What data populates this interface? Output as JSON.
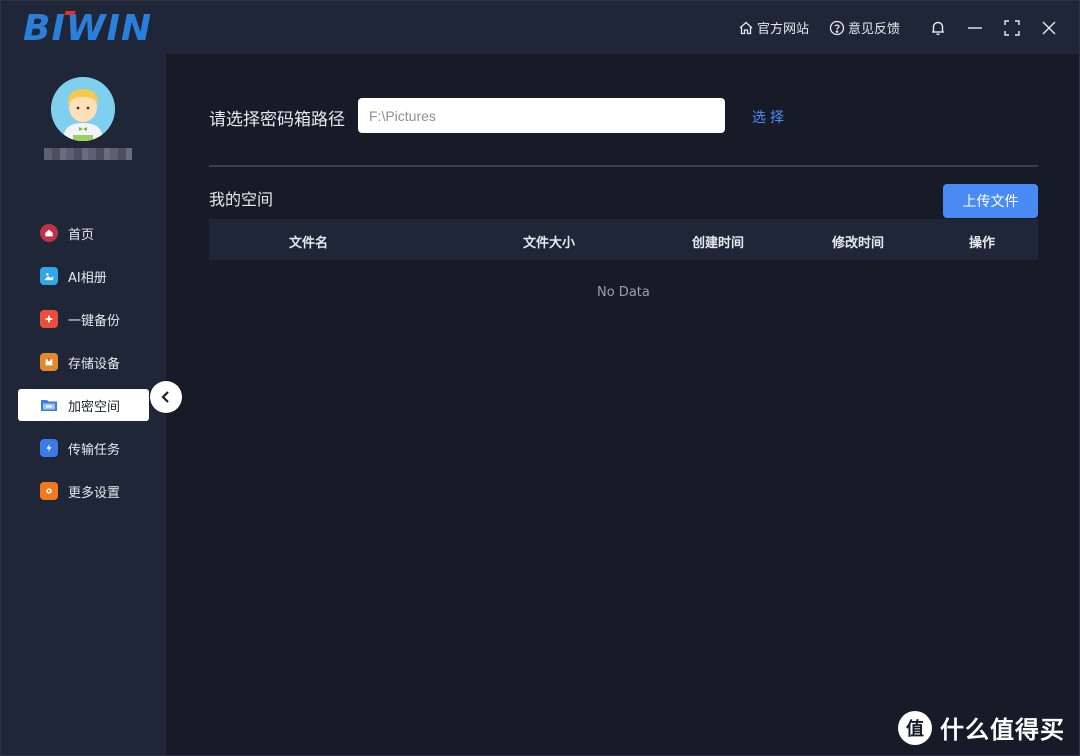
{
  "brand": {
    "logo_text": "BIWIN",
    "colors": {
      "logo": "#2b7fd9",
      "accent": "#4a8af4",
      "logo_dot": "#e03030"
    }
  },
  "titlebar": {
    "official_site": "官方网站",
    "feedback": "意见反馈",
    "icons": [
      "home-icon",
      "help-icon",
      "bell-icon",
      "minimize-icon",
      "fullscreen-icon",
      "close-icon"
    ]
  },
  "sidebar": {
    "items": [
      {
        "label": "首页",
        "icon": "home-circle-icon",
        "color": "#c0314a"
      },
      {
        "label": "AI相册",
        "icon": "photo-album-icon",
        "color": "#2fa7e8"
      },
      {
        "label": "一键备份",
        "icon": "backup-icon",
        "color": "#e94f3b"
      },
      {
        "label": "存储设备",
        "icon": "storage-icon",
        "color": "#e38a2b"
      },
      {
        "label": "加密空间",
        "icon": "folder-icon",
        "color": "#3a7be6",
        "active": true
      },
      {
        "label": "传输任务",
        "icon": "transfer-icon",
        "color": "#3a7be6"
      },
      {
        "label": "更多设置",
        "icon": "settings-icon",
        "color": "#f07a1d"
      }
    ]
  },
  "main": {
    "path_label": "请选择密码箱路径",
    "path_value": "F:\\Pictures",
    "select_label": "选择",
    "section_title": "我的空间",
    "upload_label": "上传文件",
    "table": {
      "columns": [
        "文件名",
        "文件大小",
        "创建时间",
        "修改时间",
        "操作"
      ],
      "rows": [],
      "empty_text": "No Data"
    }
  },
  "watermark": {
    "text": "什么值得买",
    "badge": "值"
  }
}
